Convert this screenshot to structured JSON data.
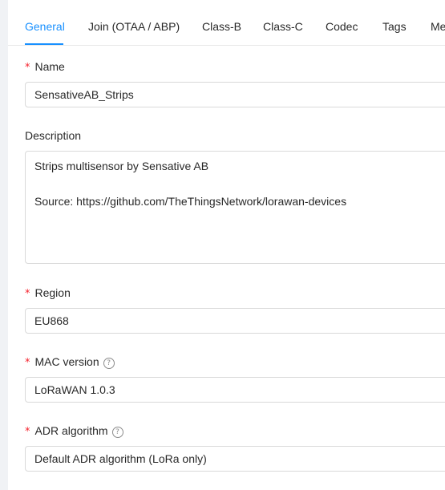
{
  "tabs": [
    {
      "label": "General",
      "active": true
    },
    {
      "label": "Join (OTAA / ABP)"
    },
    {
      "label": "Class-B"
    },
    {
      "label": "Class-C"
    },
    {
      "label": "Codec"
    },
    {
      "label": "Tags"
    },
    {
      "label": "Me"
    }
  ],
  "form": {
    "required_mark": "*",
    "name": {
      "label": "Name",
      "value": "SensativeAB_Strips"
    },
    "description": {
      "label": "Description",
      "lines": [
        "Strips multisensor by Sensative AB",
        "",
        "Source: https://github.com/TheThingsNetwork/lorawan-devices"
      ]
    },
    "region": {
      "label": "Region",
      "value": "EU868"
    },
    "mac_version": {
      "label": "MAC version",
      "value": "LoRaWAN 1.0.3",
      "help_icon": "question-circle-icon"
    },
    "adr_algorithm": {
      "label": "ADR algorithm",
      "value": "Default ADR algorithm (LoRa only)",
      "help_icon": "question-circle-icon"
    }
  },
  "colors": {
    "accent": "#1890ff",
    "required": "#f5222d"
  }
}
